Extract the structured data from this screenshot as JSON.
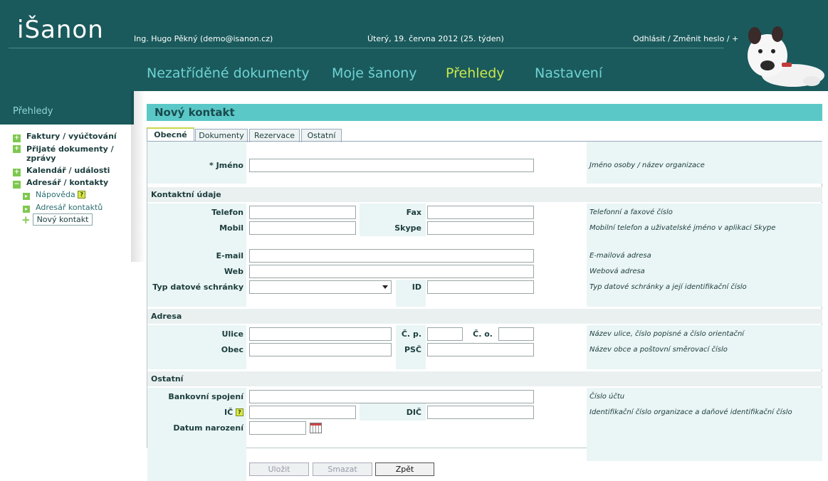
{
  "header": {
    "logo": "iŠanon",
    "user": "Ing. Hugo Pěkný (demo@isanon.cz)",
    "date": "Úterý, 19. června 2012 (25. týden)",
    "links": "Odhlásit / Změnit heslo / +",
    "nav": [
      "Nezatříděné dokumenty",
      "Moje šanony",
      "Přehledy",
      "Nastavení"
    ],
    "active_nav": "Přehledy",
    "active_color": "#c9e84a"
  },
  "sidebar": {
    "title": "Přehledy",
    "items": [
      "Faktury / vyúčtování",
      "Přijaté dokumenty / zprávy",
      "Kalendář / události",
      "Adresář / kontakty"
    ],
    "sub_items": [
      "Nápověda",
      "Adresář kontaktů"
    ],
    "new_contact": "Nový kontakt"
  },
  "page": {
    "title": "Nový kontakt",
    "tabs": [
      "Obecné",
      "Dokumenty",
      "Rezervace",
      "Ostatní"
    ],
    "active_tab": "Obecné"
  },
  "form": {
    "jmeno_label": "* Jméno",
    "jmeno_hint": "Jméno osoby / název organizace",
    "section_contact": "Kontaktní údaje",
    "telefon_label": "Telefon",
    "fax_label": "Fax",
    "phone_hint": "Telefonní a faxové číslo",
    "mobil_label": "Mobil",
    "skype_label": "Skype",
    "mobil_hint": "Mobilní telefon a uživatelské jméno v aplikaci Skype",
    "email_label": "E-mail",
    "email_hint": "E-mailová adresa",
    "web_label": "Web",
    "web_hint": "Webová adresa",
    "datovka_label": "Typ datové schránky",
    "id_label": "ID",
    "datovka_hint": "Typ datové schránky a její identifikační číslo",
    "section_address": "Adresa",
    "ulice_label": "Ulice",
    "cp_label": "Č. p.",
    "co_label": "Č. o.",
    "ulice_hint": "Název ulice, číslo popisné a číslo orientační",
    "obec_label": "Obec",
    "psc_label": "PSČ",
    "obec_hint": "Název obce a poštovní směrovací číslo",
    "section_other": "Ostatní",
    "bank_label": "Bankovní spojení",
    "bank_hint": "Číslo účtu",
    "ic_label": "IČ",
    "dic_label": "DIČ",
    "ic_hint": "Identifikační číslo organizace a daňové identifikační číslo",
    "birth_label": "Datum narození"
  },
  "buttons": {
    "save": "Uložit",
    "delete": "Smazat",
    "back": "Zpět"
  }
}
